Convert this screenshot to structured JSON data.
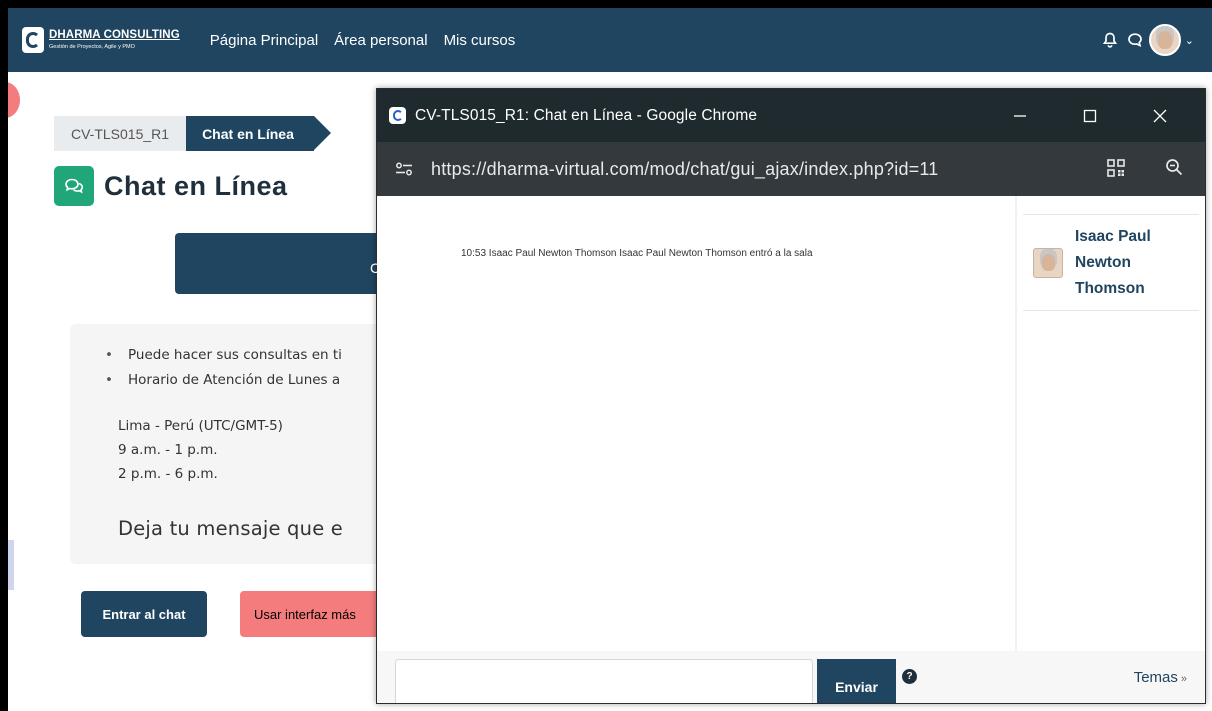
{
  "navbar": {
    "logo_title": "DHARMA CONSULTING",
    "logo_subtitle": "Gestión de Proyectos, Agile y PMO",
    "links": [
      "Página Principal",
      "Área personal",
      "Mis cursos"
    ]
  },
  "breadcrumb": {
    "course": "CV-TLS015_R1",
    "current": "Chat en Línea"
  },
  "page": {
    "title": "Chat en Línea",
    "banner_visible_char": "C",
    "info_items": [
      "Puede hacer sus consultas en ti",
      "Horario de Atención de Lunes a"
    ],
    "schedule": [
      "Lima - Perú (UTC/GMT-5)",
      "9 a.m. - 1 p.m.",
      "2 p.m. - 6 p.m."
    ],
    "cta_text": "Deja tu mensaje que e",
    "enter_chat_label": "Entrar al chat",
    "simple_interface_label": "Usar interfaz más"
  },
  "popup": {
    "window_title": "CV-TLS015_R1: Chat en Línea - Google Chrome",
    "url": "https://dharma-virtual.com/mod/chat/gui_ajax/index.php?id=11",
    "messages": [
      "10:53 Isaac Paul Newton Thomson Isaac Paul Newton Thomson entró a la sala"
    ],
    "users": [
      {
        "name": "Isaac Paul Newton Thomson"
      }
    ],
    "input_value": "",
    "send_label": "Enviar",
    "help_label": "?",
    "themes_label": "Temas",
    "themes_suffix": "»"
  },
  "colors": {
    "brand_navy": "#1f4560",
    "chat_green": "#21a67a",
    "salmon": "#f47c7c",
    "chrome_title": "#1f2a2e",
    "chrome_address": "#33393c"
  }
}
